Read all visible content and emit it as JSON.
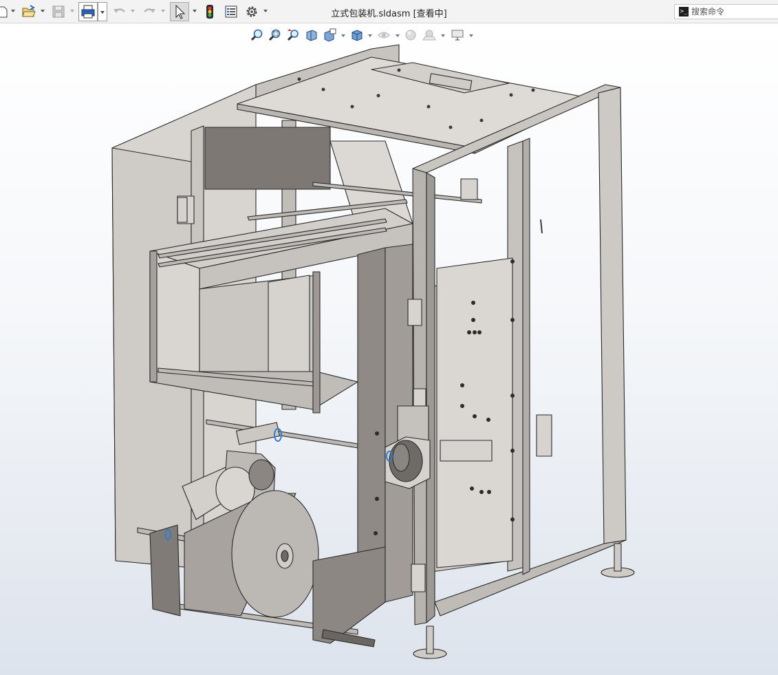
{
  "window": {
    "document_title": "立式包装机.sldasm [查看中]"
  },
  "command_search": {
    "placeholder": "搜索命令",
    "icon": "command-prompt-icon"
  },
  "toolbar": {
    "buttons": [
      {
        "name": "new-document",
        "icon": "new-document-icon",
        "has_dropdown": true
      },
      {
        "name": "open",
        "icon": "open-folder-icon",
        "has_dropdown": true
      },
      {
        "name": "save",
        "icon": "save-icon",
        "has_dropdown": true,
        "disabled": true
      },
      {
        "name": "print",
        "icon": "print-icon",
        "has_dropdown": true
      },
      {
        "name": "undo",
        "icon": "undo-icon",
        "has_dropdown": true,
        "disabled": true
      },
      {
        "name": "redo",
        "icon": "redo-icon",
        "has_dropdown": true,
        "disabled": true
      },
      {
        "name": "select",
        "icon": "select-arrow-icon",
        "has_dropdown": true,
        "active": true
      },
      {
        "name": "rebuild",
        "icon": "traffic-light-icon"
      },
      {
        "name": "file-properties",
        "icon": "file-properties-icon"
      },
      {
        "name": "options",
        "icon": "gear-icon",
        "has_dropdown": true
      }
    ]
  },
  "heads_up_toolbar": {
    "buttons": [
      {
        "name": "zoom-to-fit",
        "icon": "zoom-to-fit-icon"
      },
      {
        "name": "zoom-to-area",
        "icon": "zoom-to-area-icon"
      },
      {
        "name": "previous-view",
        "icon": "previous-view-icon"
      },
      {
        "name": "section-view",
        "icon": "section-view-icon"
      },
      {
        "name": "dynamic-annotation-views",
        "icon": "dynamic-annotation-icon",
        "has_dropdown": true
      },
      {
        "name": "view-orientation",
        "icon": "view-orientation-cube-icon",
        "has_dropdown": true
      },
      {
        "name": "hide-show-items",
        "icon": "eye-icon",
        "has_dropdown": true
      },
      {
        "name": "edit-appearance",
        "icon": "appearance-sphere-icon"
      },
      {
        "name": "apply-scene",
        "icon": "scene-icon",
        "has_dropdown": true
      },
      {
        "name": "view-settings",
        "icon": "monitor-icon",
        "has_dropdown": true
      }
    ]
  },
  "colors": {
    "metal_light": "#cfcbc6",
    "metal_mid": "#b3aea8",
    "metal_dark": "#8f8a85",
    "edge": "#2a2a2a",
    "panel_light": "#e2dfdb",
    "accent_blue": "#2f7fcf",
    "viewport_top": "#ffffff",
    "viewport_bottom": "#dde3ec"
  }
}
